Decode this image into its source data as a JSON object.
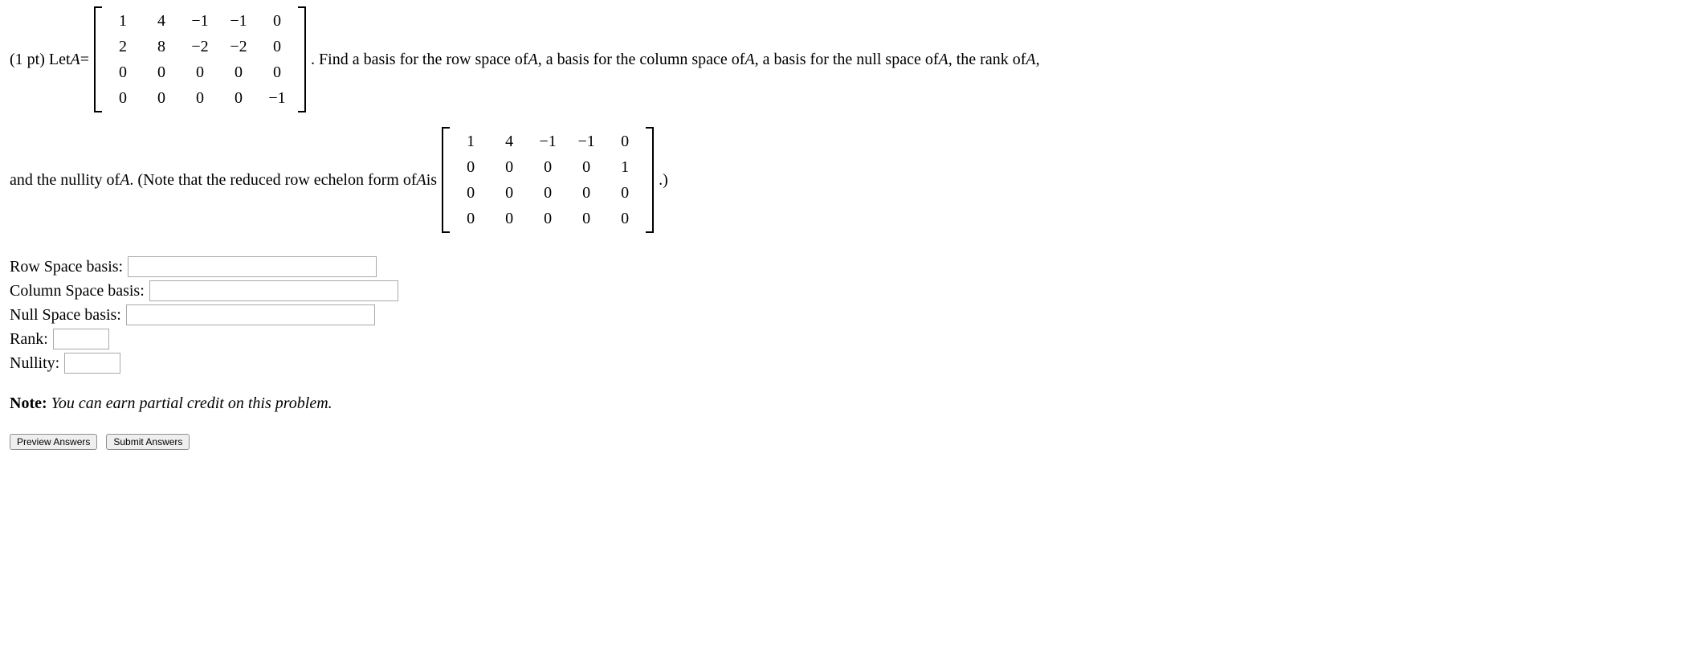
{
  "problem": {
    "prefix": "(1 pt) Let ",
    "letAvar": "A",
    "eq": " = ",
    "matrixA": [
      [
        "1",
        "4",
        "−1",
        "−1",
        "0"
      ],
      [
        "2",
        "8",
        "−2",
        "−2",
        "0"
      ],
      [
        "0",
        "0",
        "0",
        "0",
        "0"
      ],
      [
        "0",
        "0",
        "0",
        "0",
        "−1"
      ]
    ],
    "afterA_1": ". Find a basis for the row space of ",
    "A1": "A",
    "afterA_2": ", a basis for the column space of ",
    "A2": "A",
    "afterA_3": ", a basis for the null space of ",
    "A3": "A",
    "afterA_4": ", the rank of ",
    "A4": "A",
    "afterA_5": ",",
    "line2_pre": "and the nullity of ",
    "A5": "A",
    "line2_mid": ". (Note that the reduced row echelon form of ",
    "A6": "A",
    "line2_is": " is ",
    "rref": [
      [
        "1",
        "4",
        "−1",
        "−1",
        "0"
      ],
      [
        "0",
        "0",
        "0",
        "0",
        "1"
      ],
      [
        "0",
        "0",
        "0",
        "0",
        "0"
      ],
      [
        "0",
        "0",
        "0",
        "0",
        "0"
      ]
    ],
    "line2_end": ".)"
  },
  "answers": {
    "row_label": "Row Space basis:",
    "col_label": "Column Space basis:",
    "null_label": "Null Space basis:",
    "rank_label": "Rank:",
    "nullity_label": "Nullity:"
  },
  "note": {
    "bold": "Note:",
    "italic": " You can earn partial credit on this problem."
  },
  "buttons": {
    "preview": "Preview Answers",
    "submit": "Submit Answers"
  }
}
